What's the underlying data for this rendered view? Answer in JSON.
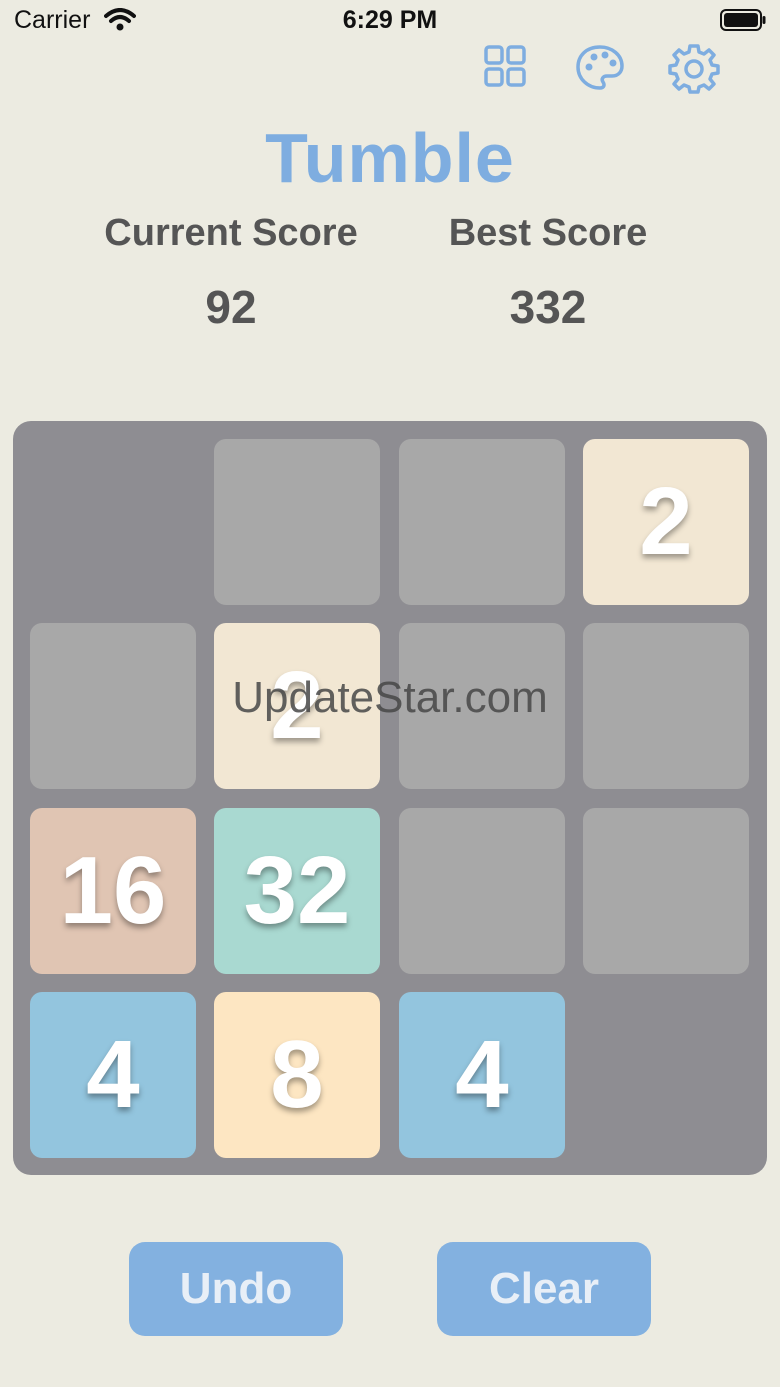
{
  "status_bar": {
    "carrier": "Carrier",
    "time": "6:29 PM"
  },
  "toolbar": {
    "icons": [
      "grid-icon",
      "palette-icon",
      "gear-icon"
    ],
    "accent_color": "#7eade0"
  },
  "title": "Tumble",
  "scores": {
    "current_label": "Current Score",
    "current_value": "92",
    "best_label": "Best Score",
    "best_value": "332"
  },
  "board": {
    "rows": [
      [
        "",
        " ",
        " ",
        "2"
      ],
      [
        " ",
        "2",
        " ",
        " "
      ],
      [
        "16",
        "32",
        " ",
        " "
      ],
      [
        "4",
        "8",
        "4",
        ""
      ]
    ],
    "tile_colors": {
      "2": "#f2e7d3",
      "4": "#93c5de",
      "8": "#fde6c2",
      "16": "#e0c5b3",
      "32": "#a9d9d1",
      "empty_cell": "#a8a8a8",
      "board": "#8e8d92"
    }
  },
  "watermark": "UpdateStar.com",
  "buttons": {
    "undo": "Undo",
    "clear": "Clear"
  }
}
